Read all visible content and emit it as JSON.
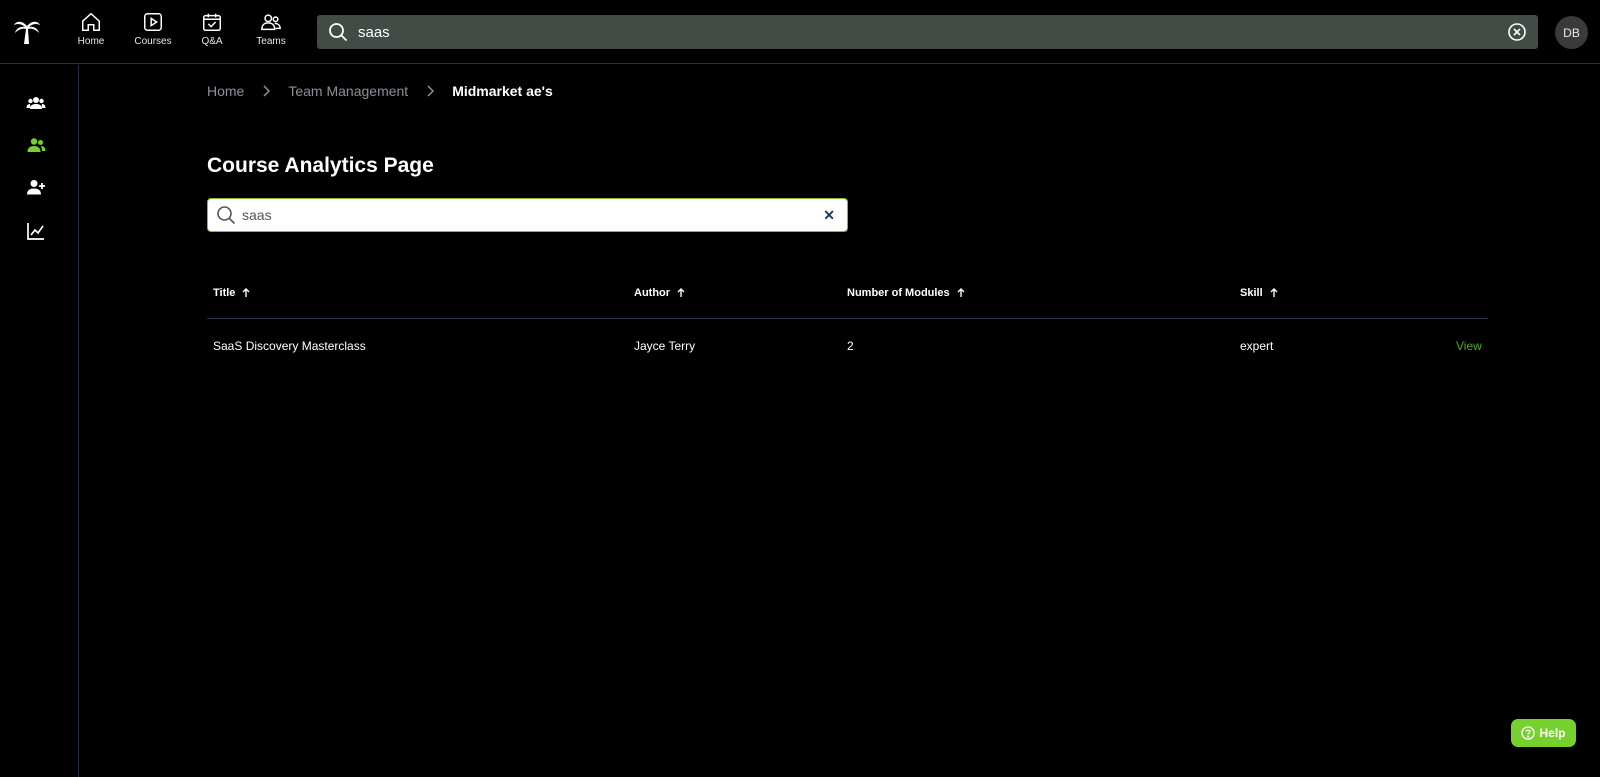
{
  "topnav": {
    "items": [
      {
        "label": "Home",
        "icon": "home-icon"
      },
      {
        "label": "Courses",
        "icon": "play-icon"
      },
      {
        "label": "Q&A",
        "icon": "calendar-check-icon"
      },
      {
        "label": "Teams",
        "icon": "people-icon"
      }
    ],
    "search_value": "saas",
    "avatar_initials": "DB"
  },
  "sidebar": {
    "items": [
      {
        "icon": "team-icon"
      },
      {
        "icon": "users-icon",
        "active": true
      },
      {
        "icon": "user-plus-icon"
      },
      {
        "icon": "chart-line-icon"
      }
    ]
  },
  "breadcrumb": [
    "Home",
    "Team Management",
    "Midmarket ae's"
  ],
  "page": {
    "title": "Course Analytics Page",
    "search_value": "saas"
  },
  "table": {
    "columns": [
      "Title",
      "Author",
      "Number of Modules",
      "Skill"
    ],
    "rows": [
      {
        "title": "SaaS Discovery Masterclass",
        "author": "Jayce Terry",
        "modules": "2",
        "skill": "expert",
        "action": "View"
      }
    ]
  },
  "help_label": "Help",
  "colors": {
    "accent": "#76d12f",
    "link": "#58a32e",
    "search_bg": "#434b47"
  }
}
